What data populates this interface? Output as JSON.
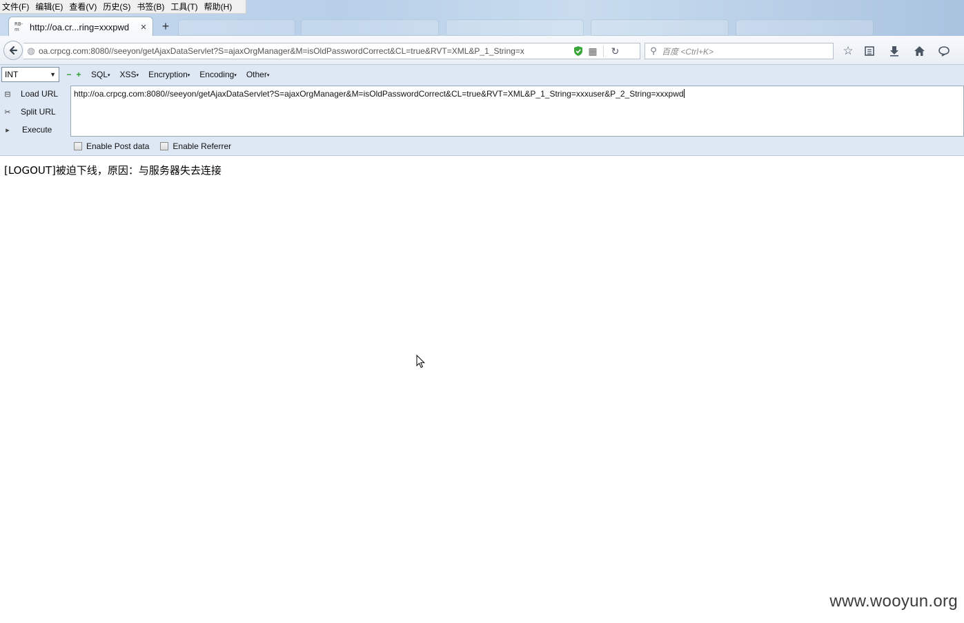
{
  "menubar": {
    "items": [
      "文件(F)",
      "编辑(E)",
      "查看(V)",
      "历史(S)",
      "书签(B)",
      "工具(T)",
      "帮助(H)"
    ]
  },
  "tab": {
    "title": "http://oa.cr...ring=xxxpwd",
    "favicon_text": "RB-m",
    "close_glyph": "×",
    "new_tab_glyph": "+"
  },
  "navbar": {
    "url": "oa.crpcg.com:8080//seeyon/getAjaxDataServlet?S=ajaxOrgManager&M=isOldPasswordCorrect&CL=true&RVT=XML&P_1_String=x",
    "search_placeholder": "百度 <Ctrl+K>"
  },
  "hackbar": {
    "select_value": "INT",
    "menus": [
      "SQL",
      "XSS",
      "Encryption",
      "Encoding",
      "Other"
    ],
    "load_url": "Load URL",
    "split_url": "Split URL",
    "execute": "Execute",
    "url_value": "http://oa.crpcg.com:8080//seeyon/getAjaxDataServlet?S=ajaxOrgManager&M=isOldPasswordCorrect&CL=true&RVT=XML&P_1_String=xxxuser&P_2_String=xxxpwd",
    "enable_post": "Enable Post data",
    "enable_referrer": "Enable Referrer"
  },
  "page": {
    "message": "[LOGOUT]被迫下线，原因：与服务器失去连接"
  },
  "watermark": "www.wooyun.org",
  "icons": {
    "shield_color": "#3aa63a",
    "plus_minus_color": "#2e9b2e"
  }
}
